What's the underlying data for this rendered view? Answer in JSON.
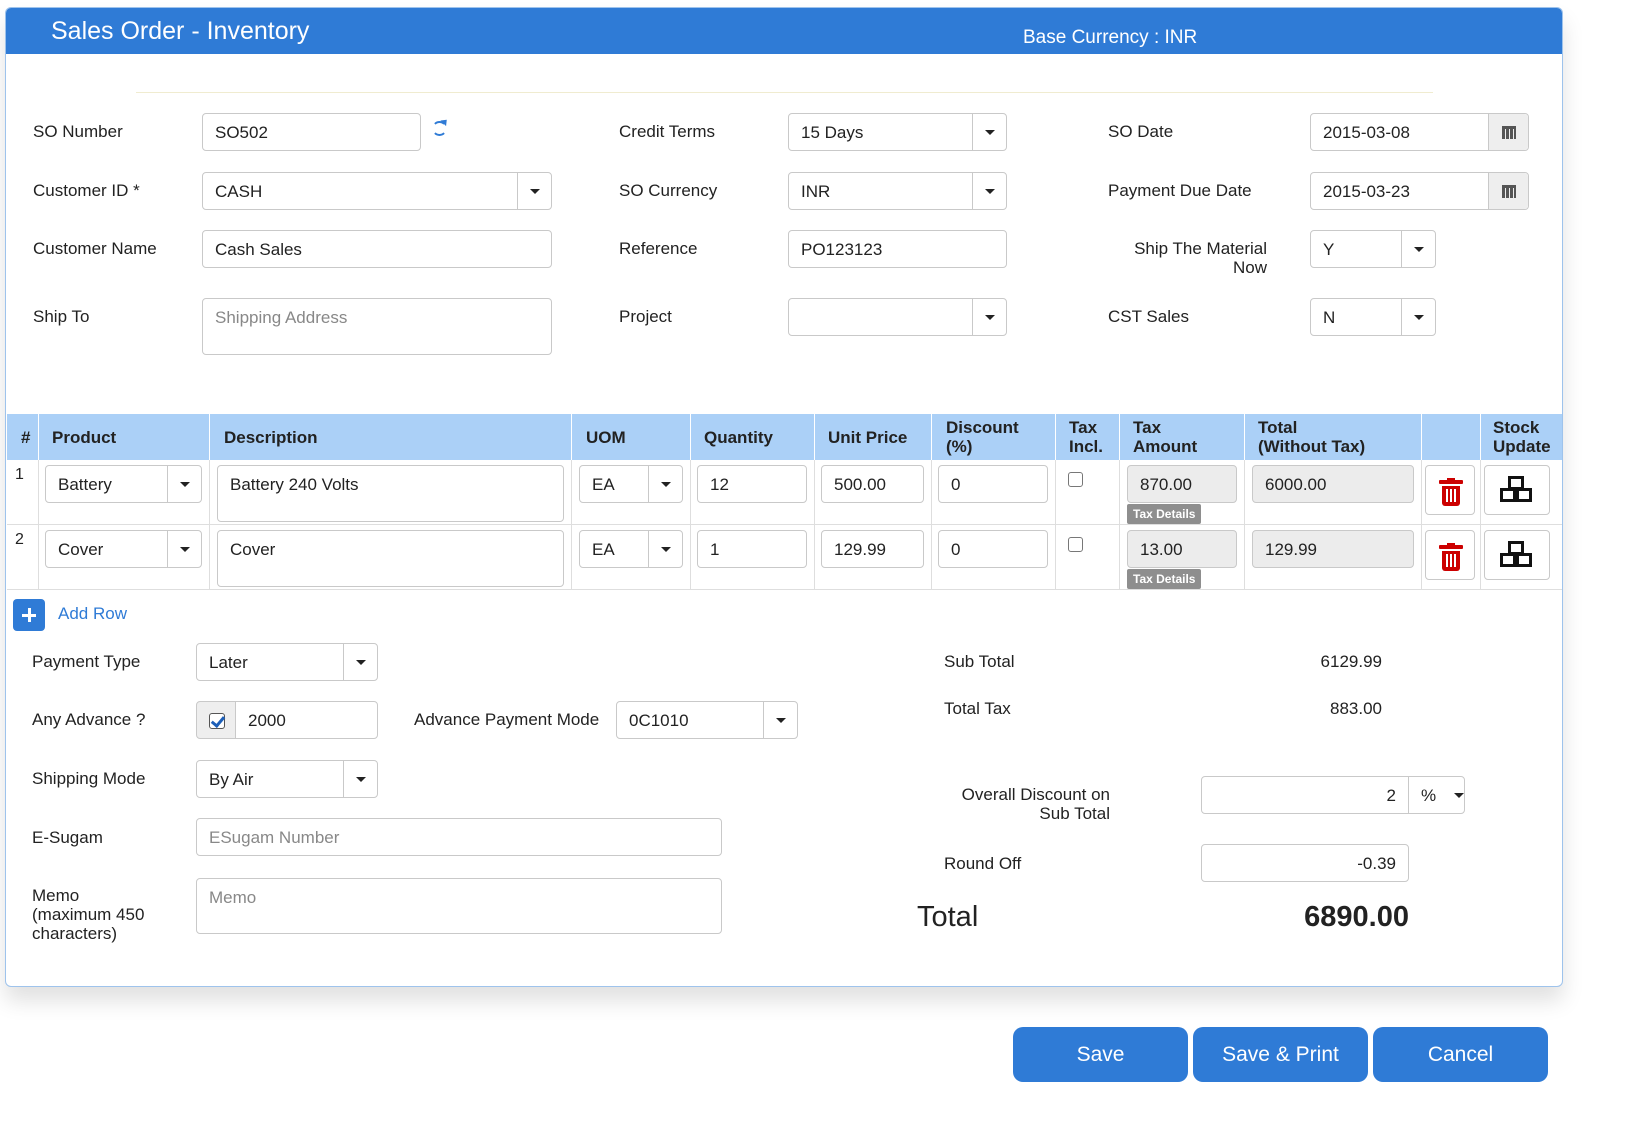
{
  "header": {
    "title": "Sales Order - Inventory",
    "base_currency": "Base Currency : INR"
  },
  "form": {
    "so_number_label": "SO Number",
    "so_number": "SO502",
    "customer_id_label": "Customer ID *",
    "customer_id": "CASH",
    "customer_name_label": "Customer Name",
    "customer_name": "Cash Sales",
    "ship_to_label": "Ship To",
    "ship_to_placeholder": "Shipping Address",
    "credit_terms_label": "Credit Terms",
    "credit_terms": "15 Days",
    "so_currency_label": "SO Currency",
    "so_currency": "INR",
    "reference_label": "Reference",
    "reference": "PO123123",
    "project_label": "Project",
    "project": "",
    "so_date_label": "SO Date",
    "so_date": "2015-03-08",
    "payment_due_date_label": "Payment Due Date",
    "payment_due_date": "2015-03-23",
    "ship_now_label_line1": "Ship The Material",
    "ship_now_label_line2": "Now",
    "ship_now": "Y",
    "cst_sales_label": "CST Sales",
    "cst_sales": "N"
  },
  "table": {
    "headers": {
      "num": "#",
      "product": "Product",
      "description": "Description",
      "uom": "UOM",
      "quantity": "Quantity",
      "unit_price": "Unit Price",
      "discount_1": "Discount",
      "discount_2": "(%)",
      "tax_incl_1": "Tax",
      "tax_incl_2": "Incl.",
      "tax_amount_1": "Tax",
      "tax_amount_2": "Amount",
      "total_1": "Total",
      "total_2": "(Without Tax)",
      "stock_1": "Stock",
      "stock_2": "Update"
    },
    "rows": [
      {
        "num": "1",
        "product": "Battery",
        "description": "Battery 240 Volts",
        "uom": "EA",
        "quantity": "12",
        "unit_price": "500.00",
        "discount": "0",
        "tax_amount": "870.00",
        "tax_details": "Tax Details",
        "total": "6000.00"
      },
      {
        "num": "2",
        "product": "Cover",
        "description": "Cover",
        "uom": "EA",
        "quantity": "1",
        "unit_price": "129.99",
        "discount": "0",
        "tax_amount": "13.00",
        "tax_details": "Tax Details",
        "total": "129.99"
      }
    ],
    "add_row": "Add Row"
  },
  "footer": {
    "payment_type_label": "Payment Type",
    "payment_type": "Later",
    "any_advance_label": "Any Advance ?",
    "advance_amount": "2000",
    "advance_mode_label": "Advance Payment Mode",
    "advance_mode": "0C1010",
    "shipping_mode_label": "Shipping Mode",
    "shipping_mode": "By Air",
    "esugam_label": "E-Sugam",
    "esugam_placeholder": "ESugam Number",
    "memo_label_1": "Memo",
    "memo_label_2": "(maximum 450",
    "memo_label_3": "characters)",
    "memo_placeholder": "Memo",
    "sub_total_label": "Sub Total",
    "sub_total": "6129.99",
    "total_tax_label": "Total Tax",
    "total_tax": "883.00",
    "overall_discount_label_1": "Overall Discount on",
    "overall_discount_label_2": "Sub Total",
    "overall_discount": "2",
    "discount_unit": "%",
    "round_off_label": "Round Off",
    "round_off": "-0.39",
    "total_label": "Total",
    "total": "6890.00"
  },
  "buttons": {
    "save": "Save",
    "save_print": "Save & Print",
    "cancel": "Cancel"
  },
  "colors": {
    "primary": "#2f7bd6",
    "table_header": "#abd0f7",
    "delete": "#cc0000"
  }
}
